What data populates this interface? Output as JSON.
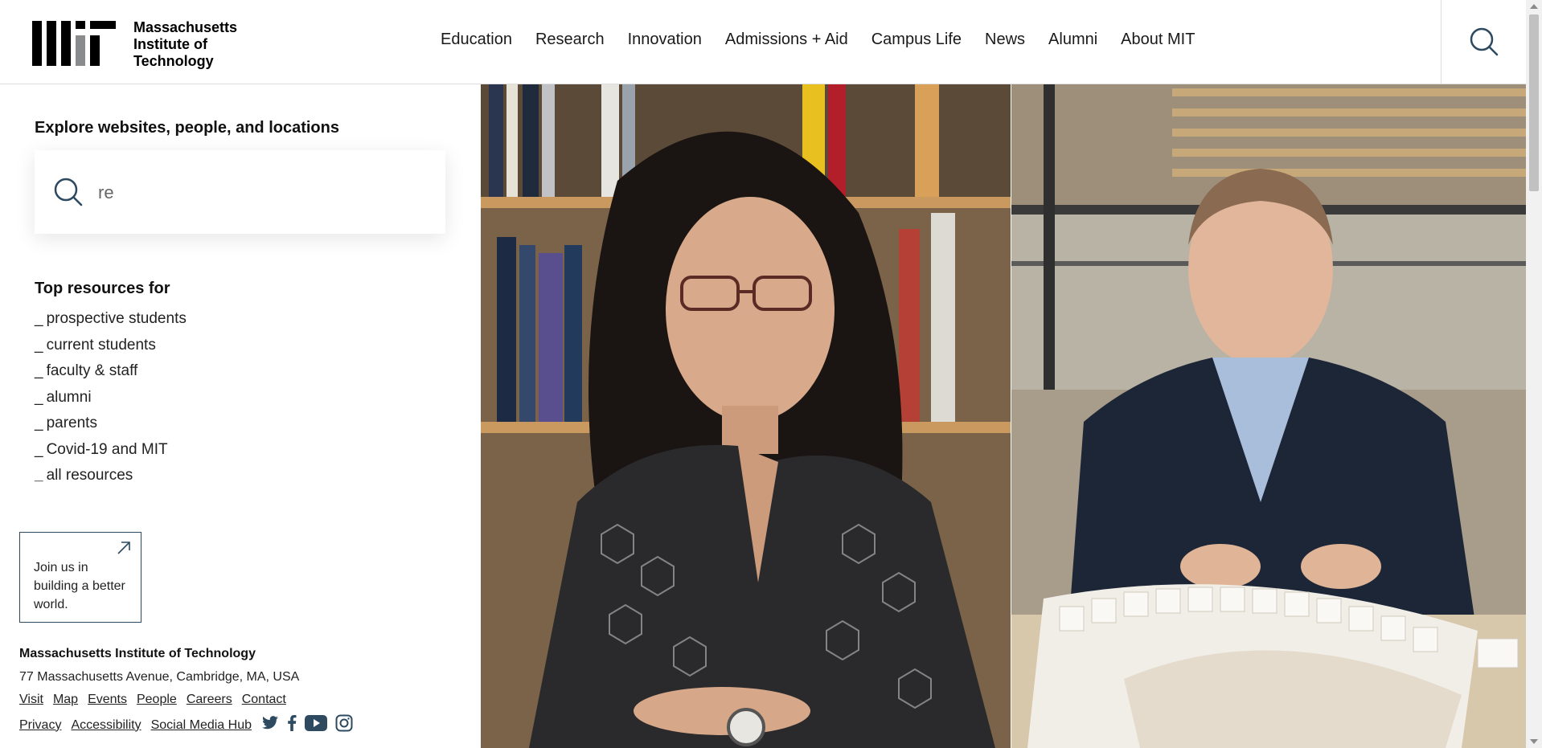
{
  "header": {
    "logo_lines": [
      "Massachusetts",
      "Institute of",
      "Technology"
    ],
    "nav": [
      "Education",
      "Research",
      "Innovation",
      "Admissions + Aid",
      "Campus Life",
      "News",
      "Alumni",
      "About MIT"
    ],
    "search_icon": "search-icon"
  },
  "search": {
    "title": "Explore websites, people, and locations",
    "value": "re"
  },
  "resources": {
    "title": "Top resources for",
    "items": [
      "prospective students",
      "current students",
      "faculty & staff",
      "alumni",
      "parents",
      "Covid-19 and MIT",
      "all resources"
    ]
  },
  "join": {
    "text": "Join us in building a better world.",
    "icon": "arrow-up-right-icon"
  },
  "footer": {
    "name": "Massachusetts Institute of Technology",
    "address": "77 Massachusetts Avenue, Cambridge, MA, USA",
    "links_row1": [
      "Visit",
      "Map",
      "Events",
      "People",
      "Careers",
      "Contact"
    ],
    "links_row2": [
      "Privacy",
      "Accessibility",
      "Social Media Hub"
    ],
    "social_icons": [
      "twitter-icon",
      "facebook-icon",
      "youtube-icon",
      "instagram-icon"
    ]
  },
  "colors": {
    "accent": "#2d4a60",
    "logo_gray": "#8a8b8c"
  }
}
